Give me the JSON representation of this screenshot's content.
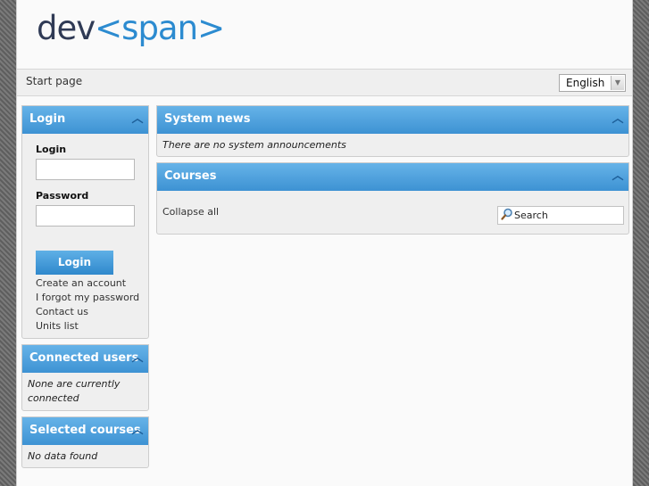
{
  "header": {
    "logo_dev": "dev",
    "logo_lt": "<",
    "logo_span": "span",
    "logo_gt": ">"
  },
  "nav": {
    "start_page": "Start page",
    "language": "English"
  },
  "login_box": {
    "title": "Login",
    "login_label": "Login",
    "password_label": "Password",
    "login_button": "Login",
    "links": [
      "Create an account",
      "I forgot my password",
      "Contact us",
      "Units list"
    ]
  },
  "connected_users": {
    "title": "Connected users",
    "message_line1": "None are currently",
    "message_line2": "connected"
  },
  "selected_courses": {
    "title": "Selected courses",
    "message": "No data found"
  },
  "system_news": {
    "title": "System news",
    "message": "There are no system announcements"
  },
  "courses": {
    "title": "Courses",
    "collapse_all": "Collapse all",
    "search_placeholder": "Search"
  },
  "colors": {
    "header_blue_top": "#66b3e8",
    "header_blue_bottom": "#3d92d3",
    "logo_dark": "#2f3a55",
    "logo_blue": "#2c8bd0"
  }
}
